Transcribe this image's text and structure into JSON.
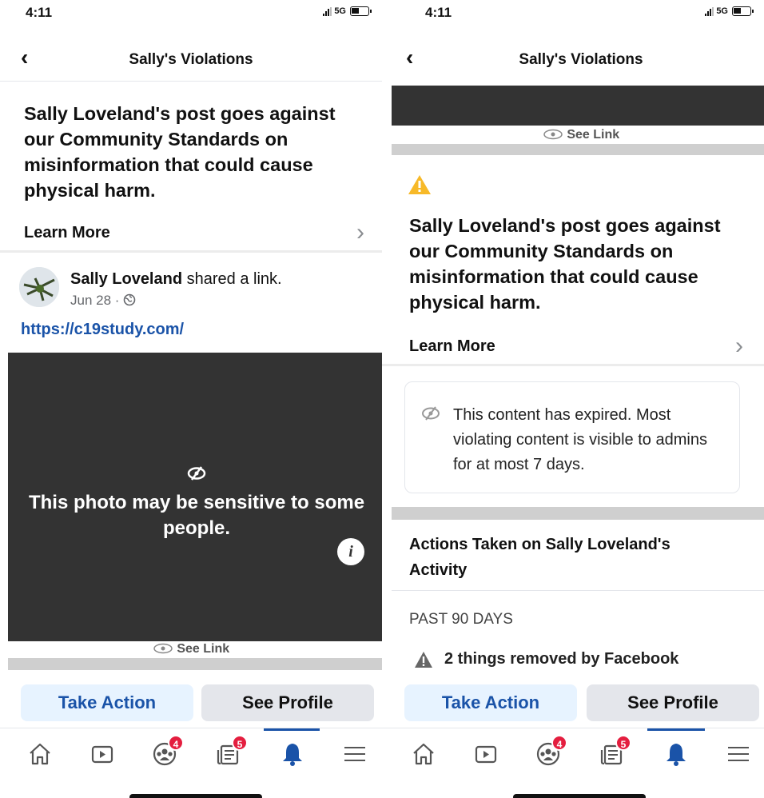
{
  "status": {
    "time": "4:11",
    "network": "5G"
  },
  "nav": {
    "title": "Sally's Violations"
  },
  "violation": {
    "headline": "Sally Loveland's post goes against our Community Standards on misinformation that could cause physical harm.",
    "learn_more": "Learn More"
  },
  "post": {
    "author": "Sally Loveland",
    "action": " shared a link.",
    "date": "Jun 28 ·",
    "url": "https://c19study.com/",
    "sensitive_text": "This photo may be sensitive to some people.",
    "see_link": "See Link"
  },
  "expired": {
    "text": "This content has expired. Most violating content is visible to admins for at most 7 days."
  },
  "activity": {
    "title": "Actions Taken on Sally Loveland's Activity",
    "period": "PAST 90 DAYS",
    "removed": "2 things removed by Facebook"
  },
  "buttons": {
    "take_action": "Take Action",
    "see_profile": "See Profile"
  },
  "tabs": {
    "groups_badge": "4",
    "news_badge": "5"
  },
  "colors": {
    "accent": "#1a53a8",
    "badge": "#e41e3f",
    "warning": "#f7b928"
  }
}
